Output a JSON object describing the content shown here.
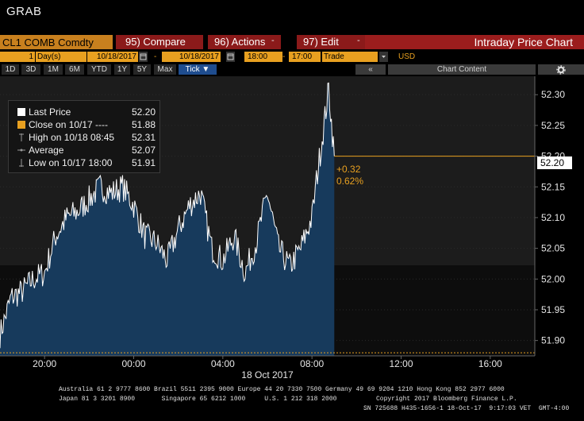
{
  "window_title": "GRAB",
  "toolbar": {
    "ticker": "CL1 COMB Comdty",
    "compare": "95) Compare",
    "actions": "96) Actions",
    "edit": "97) Edit",
    "chart_title": "Intraday Price Chart"
  },
  "controls": {
    "period_num": "1",
    "period_unit": "Day(s)",
    "start_date": "10/18/2017",
    "dash1": "-",
    "end_date": "10/18/2017",
    "start_time": "18:00",
    "dash2": "-",
    "end_time": "17:00",
    "field": "Trade",
    "currency": "USD"
  },
  "periods": [
    "1D",
    "3D",
    "1M",
    "6M",
    "YTD",
    "1Y",
    "5Y",
    "Max"
  ],
  "tick_label": "Tick ▼",
  "collapse_label": "«",
  "chart_content_label": "Chart Content",
  "settings_icon": "gear-icon",
  "legend": [
    {
      "label": "Last Price",
      "value": "52.20",
      "color": "#ffffff"
    },
    {
      "label": "Close on 10/17 ----",
      "value": "51.88",
      "color": "#e8a020"
    },
    {
      "label": "High on 10/18 08:45",
      "value": "52.31",
      "color": "#888888"
    },
    {
      "label": "Average",
      "value": "52.07",
      "color": "#888888"
    },
    {
      "label": "Low on 10/17 18:00",
      "value": "51.91",
      "color": "#888888"
    }
  ],
  "change": {
    "abs": "+0.32",
    "pct": "0.62%"
  },
  "last_price_label": "52.20",
  "chart_data": {
    "type": "area",
    "y_ticks": [
      "52.30",
      "52.25",
      "52.20",
      "52.15",
      "52.10",
      "52.05",
      "52.00",
      "51.95",
      "51.90"
    ],
    "x_ticks": [
      "20:00",
      "00:00",
      "04:00",
      "08:00",
      "12:00",
      "16:00"
    ],
    "x_date_label": "18 Oct 2017",
    "ylim": [
      51.875,
      52.33
    ],
    "close_line": 51.88,
    "last_price": 52.2,
    "x_hours": [
      18,
      18.5,
      19,
      19.5,
      20,
      20.5,
      21,
      21.5,
      22,
      22.5,
      23,
      23.5,
      24,
      24.5,
      25,
      25.5,
      26,
      26.5,
      27,
      27.5,
      28,
      28.5,
      29,
      29.5,
      30,
      30.5,
      31,
      31.5,
      32,
      32.2,
      32.5,
      32.75,
      33
    ],
    "values": [
      51.91,
      51.97,
      51.98,
      52.0,
      52.01,
      52.07,
      52.1,
      52.11,
      52.13,
      52.15,
      52.14,
      52.15,
      52.12,
      52.07,
      52.06,
      52.03,
      52.08,
      52.12,
      52.14,
      52.05,
      52.03,
      52.07,
      52.01,
      52.06,
      52.14,
      52.05,
      52.02,
      52.05,
      52.1,
      52.16,
      52.24,
      52.31,
      52.2
    ],
    "colors": {
      "line": "#ffffff",
      "fill": "#173a5c",
      "close_line": "#e8a020",
      "last_line": "#e8a020"
    }
  },
  "footer": {
    "line1": "Australia 61 2 9777 8600 Brazil 5511 2395 9000 Europe 44 20 7330 7500 Germany 49 69 9204 1210 Hong Kong 852 2977 6000",
    "line2a": "Japan 81 3 3201 8900       Singapore 65 6212 1000     U.S. 1 212 318 2000",
    "line2b": "Copyright 2017 Bloomberg Finance L.P.",
    "line3": "SN 725688 H435-1656-1 18-Oct-17  9:17:03 VET  GMT-4:00"
  }
}
